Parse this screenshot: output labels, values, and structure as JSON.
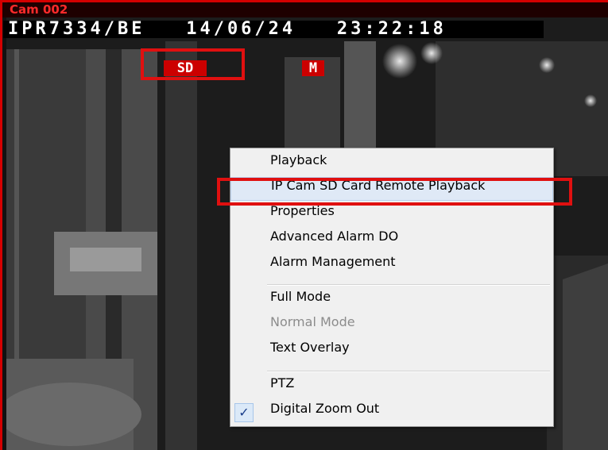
{
  "window": {
    "cam_label": "Cam 002",
    "border_color": "#d40000"
  },
  "osd": {
    "camera_id": "IPR7334/BE",
    "date": "14/06/24",
    "time": "23:22:18",
    "sd_badge": "SD",
    "motion_badge": "M",
    "badge_color": "#cc0000"
  },
  "context_menu": {
    "items": [
      {
        "label": "Playback",
        "enabled": true
      },
      {
        "label": "IP Cam SD Card Remote Playback",
        "enabled": true,
        "highlighted": true
      },
      {
        "label": "Properties",
        "enabled": true
      },
      {
        "label": "Advanced Alarm DO",
        "enabled": true
      },
      {
        "label": "Alarm Management",
        "enabled": true
      },
      {
        "label": "Full Mode",
        "enabled": true
      },
      {
        "label": "Normal Mode",
        "enabled": false
      },
      {
        "label": "Text Overlay",
        "enabled": true
      },
      {
        "label": "PTZ",
        "enabled": true
      },
      {
        "label": "Digital Zoom Out",
        "enabled": true,
        "checked": true
      }
    ],
    "check_icon": "checkmark-icon",
    "annotation_color": "#e01010"
  }
}
